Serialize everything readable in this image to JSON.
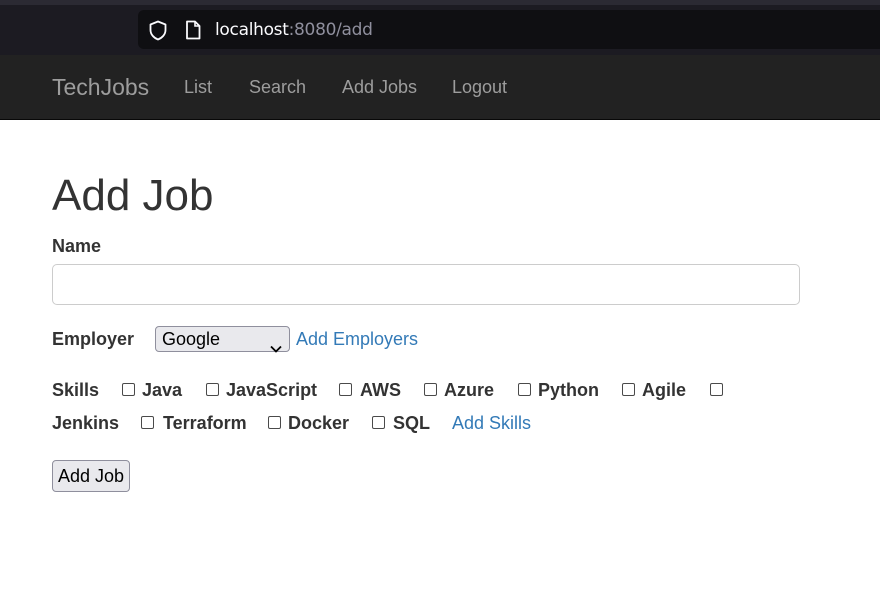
{
  "browser": {
    "url_host": "localhost",
    "url_path": ":8080/add"
  },
  "navbar": {
    "brand": "TechJobs",
    "items": [
      {
        "label": "List"
      },
      {
        "label": "Search"
      },
      {
        "label": "Add Jobs"
      },
      {
        "label": "Logout"
      }
    ]
  },
  "form": {
    "title": "Add Job",
    "name_label": "Name",
    "name_value": "",
    "employer_label": "Employer",
    "employer_selected": "Google",
    "add_employers_link": "Add Employers",
    "skills_label": "Skills",
    "skills": [
      {
        "label": "Java",
        "checked": false
      },
      {
        "label": "JavaScript",
        "checked": false
      },
      {
        "label": "AWS",
        "checked": false
      },
      {
        "label": "Azure",
        "checked": false
      },
      {
        "label": "Python",
        "checked": false
      },
      {
        "label": "Agile",
        "checked": false
      },
      {
        "label": "Jenkins",
        "checked": false
      },
      {
        "label": "Terraform",
        "checked": false
      },
      {
        "label": "Docker",
        "checked": false
      },
      {
        "label": "SQL",
        "checked": false
      }
    ],
    "add_skills_link": "Add Skills",
    "submit_label": "Add Job"
  },
  "colors": {
    "navbar_bg": "#222222",
    "nav_text": "#9d9d9d",
    "link": "#337ab7",
    "text": "#333333"
  }
}
